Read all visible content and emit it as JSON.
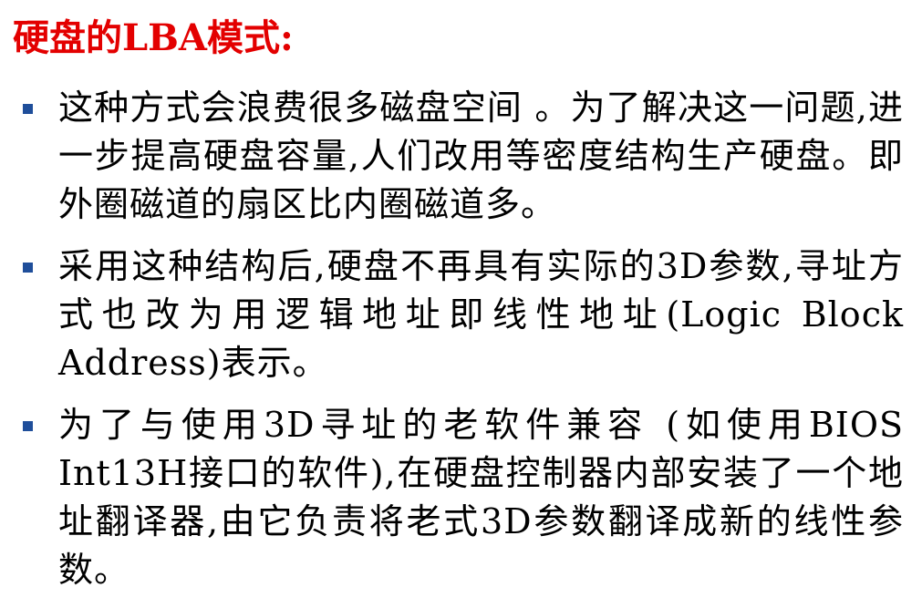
{
  "title": "硬盘的LBA模式:",
  "colors": {
    "title": "#e30000",
    "bullet_marker": "#1f4e9a",
    "text": "#000000"
  },
  "bullets": [
    {
      "text": "这种方式会浪费很多磁盘空间 。为了解决这一问题,进一步提高硬盘容量,人们改用等密度结构生产硬盘。即外圈磁道的扇区比内圈磁道多。"
    },
    {
      "text": "采用这种结构后,硬盘不再具有实际的3D参数,寻址方式也改为用逻辑地址即线性地址(Logic Block Address)表示。"
    },
    {
      "text": "为了与使用3D寻址的老软件兼容 (如使用BIOS Int13H接口的软件),在硬盘控制器内部安装了一个地址翻译器,由它负责将老式3D参数翻译成新的线性参数。"
    }
  ]
}
